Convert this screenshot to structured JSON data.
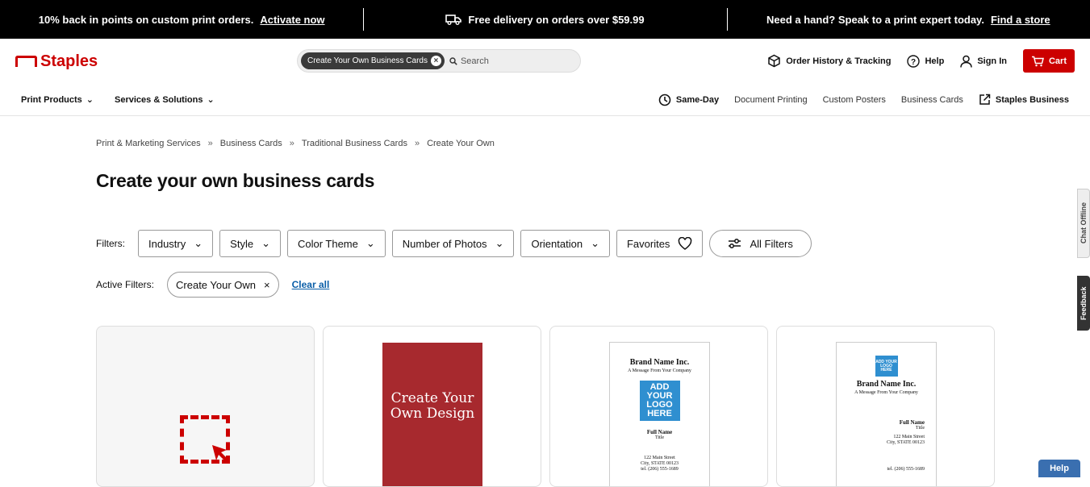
{
  "promo": {
    "left_text": "10% back in points on custom print orders.",
    "left_link": "Activate now",
    "center_text": "Free delivery on orders over $59.99",
    "right_text": "Need a hand? Speak to a print expert today.",
    "right_link": "Find a store"
  },
  "header": {
    "logo": "Staples",
    "search_chip": "Create Your Own Business Cards",
    "search_placeholder": "Search",
    "order_history": "Order History & Tracking",
    "help": "Help",
    "sign_in": "Sign In",
    "cart": "Cart"
  },
  "nav": {
    "print_products": "Print Products",
    "services": "Services & Solutions",
    "same_day": "Same-Day",
    "document_printing": "Document Printing",
    "custom_posters": "Custom Posters",
    "business_cards": "Business Cards",
    "staples_business": "Staples Business"
  },
  "breadcrumb": [
    "Print & Marketing Services",
    "Business Cards",
    "Traditional Business Cards",
    "Create Your Own"
  ],
  "breadcrumb_sep": "»",
  "page_title": "Create your own business cards",
  "filters": {
    "label": "Filters:",
    "items": [
      "Industry",
      "Style",
      "Color Theme",
      "Number of Photos",
      "Orientation"
    ],
    "favorites": "Favorites",
    "all_filters": "All Filters"
  },
  "active_filters": {
    "label": "Active Filters:",
    "chip": "Create Your Own",
    "chip_remove": "×",
    "clear_all": "Clear all"
  },
  "cards": {
    "red_card_text": "Create Your Own Design",
    "card3": {
      "brand": "Brand Name Inc.",
      "message": "A Message From Your Company",
      "logo": "ADD YOUR LOGO HERE",
      "name": "Full Name",
      "title": "Title",
      "address1": "122 Main Street",
      "address2": "City, STATE 00123",
      "phone": "tel. (206) 555-1689"
    },
    "card4": {
      "logo": "ADD YOUR LOGO HERE",
      "brand": "Brand Name Inc.",
      "message": "A Message From Your Company",
      "name": "Full Name",
      "title": "Title",
      "address1": "122 Main Street",
      "address2": "City, STATE 00123",
      "phone": "tel. (206) 555-1689"
    }
  },
  "side": {
    "chat_offline": "Chat Offline",
    "feedback": "Feedback",
    "help": "Help"
  },
  "colors": {
    "brand_red": "#cc0000",
    "link_blue": "#0a5ea8",
    "card_red": "#a7292e",
    "logo_blue": "#2f8fd0"
  }
}
